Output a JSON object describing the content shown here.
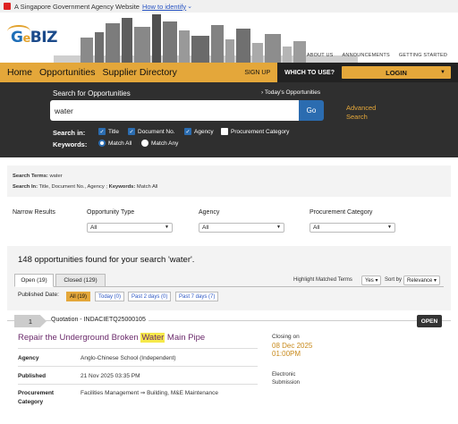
{
  "gov_bar": {
    "text": "A Singapore Government Agency Website",
    "link": "How to identify"
  },
  "header": {
    "logo_e": "e",
    "logo_g": "G",
    "logo_biz": "BIZ",
    "links": [
      "ABOUT US",
      "ANNOUNCEMENTS",
      "GETTING STARTED"
    ]
  },
  "nav": {
    "items": [
      "Home",
      "Opportunities",
      "Supplier Directory"
    ],
    "signup": "SIGN UP",
    "which": "WHICH TO USE?",
    "login": "LOGIN"
  },
  "search": {
    "title": "Search for Opportunities",
    "today": "› Today's Opportunities",
    "value": "water",
    "go": "Go",
    "advanced": [
      "Advanced",
      "Search"
    ],
    "search_in_label": "Search in:",
    "options": [
      {
        "label": "Title",
        "checked": true
      },
      {
        "label": "Document No.",
        "checked": true
      },
      {
        "label": "Agency",
        "checked": true
      },
      {
        "label": "Procurement Category",
        "checked": false
      }
    ],
    "keywords_label": "Keywords:",
    "match_all": "Match All",
    "match_any": "Match Any"
  },
  "terms": {
    "terms_label": "Search Terms:",
    "terms_value": "water",
    "in_label": "Search In:",
    "in_value": "Title, Document No., Agency ;",
    "kw_label": "Keywords:",
    "kw_value": "Match All"
  },
  "narrow": {
    "title": "Narrow Results",
    "filters": [
      {
        "label": "Opportunity Type",
        "value": "All"
      },
      {
        "label": "Agency",
        "value": "All"
      },
      {
        "label": "Procurement Category",
        "value": "All"
      }
    ]
  },
  "results": {
    "count_text": "148 opportunities found for your search 'water'.",
    "tabs": [
      "Open (19)",
      "Closed (129)"
    ],
    "highlight_label": "Highlight Matched Terms",
    "highlight_value": "Yes",
    "sort_label": "Sort by",
    "sort_value": "Relevance",
    "published_label": "Published Date:",
    "chips": [
      "All (19)",
      "Today (0)",
      "Past 2 days (0)",
      "Past 7 days (7)"
    ]
  },
  "card": {
    "index": "1",
    "quotation": "Quotation - INDACIETQ25000105",
    "status": "OPEN",
    "title_pre": "Repair the Underground Broken ",
    "title_match": "Water",
    "title_post": " Main Pipe",
    "agency_label": "Agency",
    "agency_value": "Anglo-Chinese School (Independent)",
    "published_label": "Published",
    "published_value": "21 Nov 2025 03:35 PM",
    "category_label": "Procurement Category",
    "category_value": "Facilities Management ⇒ Building, M&E Maintenance",
    "closing_label": "Closing on",
    "closing_date": "08 Dec 2025",
    "closing_time": "01:00PM",
    "submission": [
      "Electronic",
      "Submission"
    ]
  },
  "colors": {
    "accent": "#e4a73a",
    "dark": "#2f2f2f",
    "link": "#2b56c4",
    "title": "#6b2a6b",
    "highlight": "#f6e94a"
  }
}
